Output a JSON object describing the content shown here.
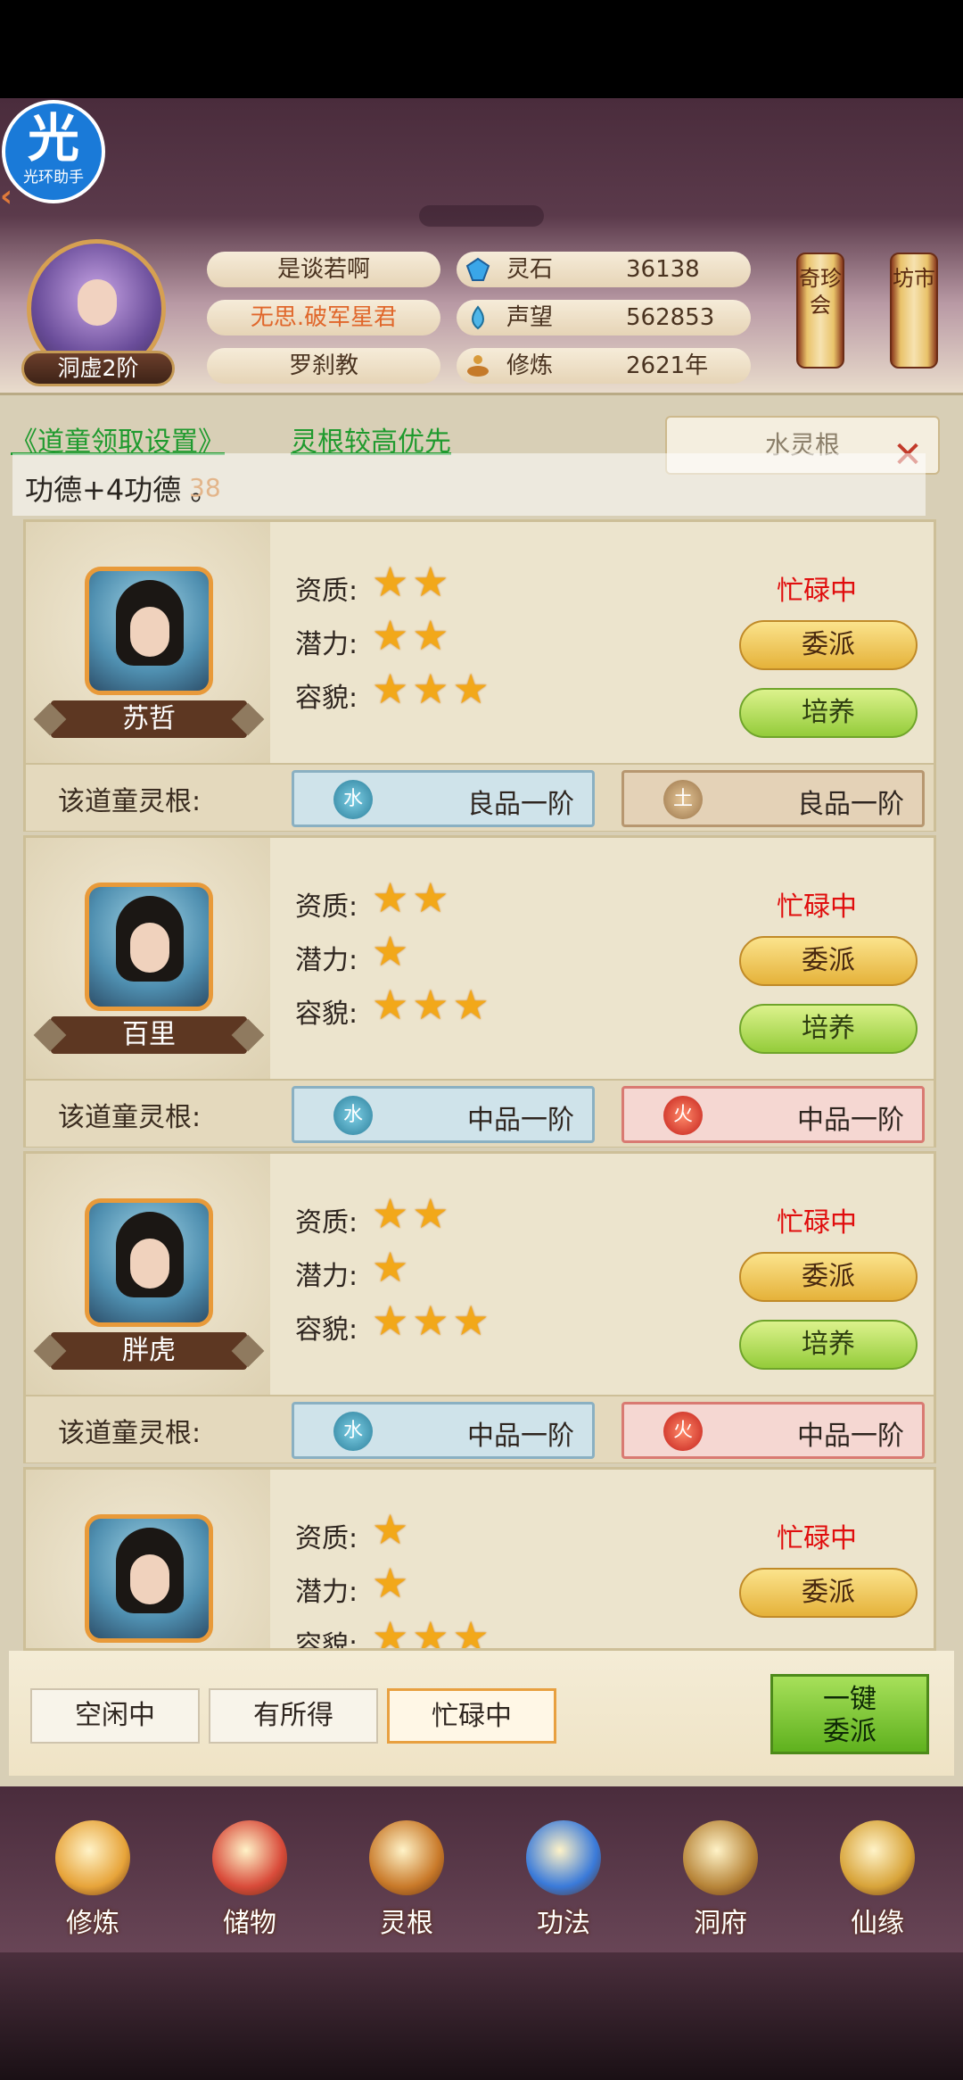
{
  "assistant": {
    "logo_char": "光",
    "logo_label": "光环助手"
  },
  "profile": {
    "rank": "洞虚2阶",
    "name": "是谈若啊",
    "title": "无思.破军星君",
    "sect": "罗刹教"
  },
  "stats": [
    {
      "icon": "spirit-stone-icon",
      "label": "灵石",
      "value": "36138"
    },
    {
      "icon": "reputation-icon",
      "label": "声望",
      "value": "562853"
    },
    {
      "icon": "cultivation-icon",
      "label": "修炼",
      "value": "2621年"
    }
  ],
  "side_buttons": [
    {
      "label": "奇珍会"
    },
    {
      "label": "坊市"
    }
  ],
  "settings": {
    "link1": "《道童领取设置》",
    "link2": "灵根较高优先",
    "select_value": "水灵根"
  },
  "toast": {
    "text": "功德+4功德 。",
    "number": "38"
  },
  "attr_labels": {
    "quality": "资质:",
    "potential": "潜力:",
    "appearance": "容貌:"
  },
  "root_label": "该道童灵根:",
  "buttons": {
    "assign": "委派",
    "train": "培养"
  },
  "cards": [
    {
      "name": "苏哲",
      "quality": 2,
      "potential": 2,
      "appearance": 3,
      "status": "忙碌中",
      "roots": [
        {
          "element": "水",
          "type": "water",
          "grade": "良品一阶"
        },
        {
          "element": "土",
          "type": "earth",
          "grade": "良品一阶"
        }
      ]
    },
    {
      "name": "百里",
      "quality": 2,
      "potential": 1,
      "appearance": 3,
      "status": "忙碌中",
      "roots": [
        {
          "element": "水",
          "type": "water",
          "grade": "中品一阶"
        },
        {
          "element": "火",
          "type": "fire",
          "grade": "中品一阶"
        }
      ]
    },
    {
      "name": "胖虎",
      "quality": 2,
      "potential": 1,
      "appearance": 3,
      "status": "忙碌中",
      "roots": [
        {
          "element": "水",
          "type": "water",
          "grade": "中品一阶"
        },
        {
          "element": "火",
          "type": "fire",
          "grade": "中品一阶"
        }
      ]
    },
    {
      "name": "",
      "quality": 1,
      "potential": 1,
      "appearance": 3,
      "status": "忙碌中",
      "roots": []
    }
  ],
  "appearance_partial_label": "容貌",
  "filters": [
    {
      "label": "空闲中",
      "active": false
    },
    {
      "label": "有所得",
      "active": false
    },
    {
      "label": "忙碌中",
      "active": true
    }
  ],
  "one_click": "一键\n委派",
  "nav": [
    {
      "label": "修炼",
      "icon": "cultivation-hood-icon",
      "color": "#e7a43a"
    },
    {
      "label": "储物",
      "icon": "storage-bag-icon",
      "color": "#d94b3a"
    },
    {
      "label": "灵根",
      "icon": "spirit-root-icon",
      "color": "#c97a2a"
    },
    {
      "label": "功法",
      "icon": "technique-book-icon",
      "color": "#3a7ad9"
    },
    {
      "label": "洞府",
      "icon": "cave-mansion-icon",
      "color": "#b8863a"
    },
    {
      "label": "仙缘",
      "icon": "gourd-icon",
      "color": "#d8a43a"
    }
  ]
}
